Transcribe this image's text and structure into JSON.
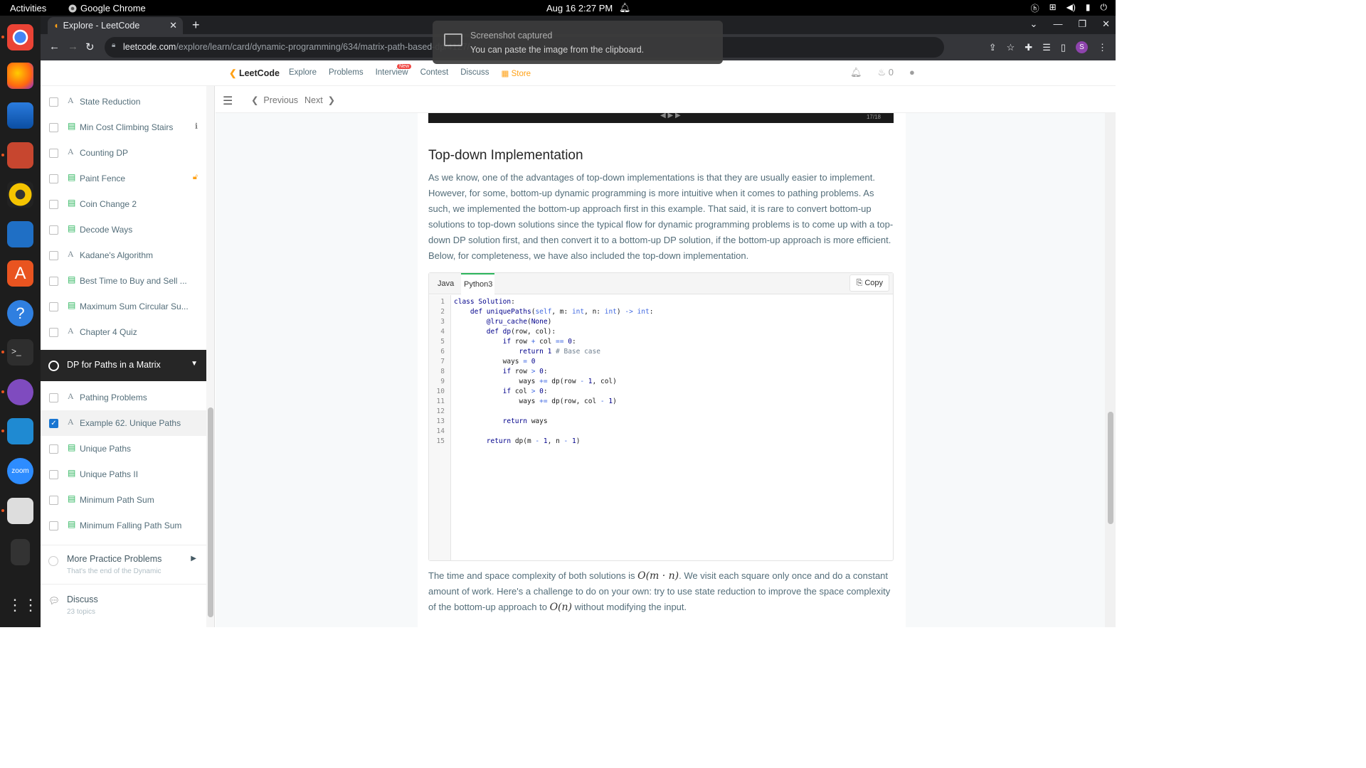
{
  "os": {
    "activities": "Activities",
    "app_name": "Google Chrome",
    "clock": "Aug 16  2:27 PM"
  },
  "browser": {
    "tab_title": "Explore - LeetCode",
    "url_host": "leetcode.com",
    "url_path": "/explore/learn/card/dynamic-programming/634/matrix-path-based-dp/4127/",
    "profile_initial": "S"
  },
  "toast": {
    "title": "Screenshot captured",
    "body": "You can paste the image from the clipboard."
  },
  "header": {
    "logo": "LeetCode",
    "nav": [
      "Explore",
      "Problems",
      "Interview",
      "Contest",
      "Discuss"
    ],
    "new_badge": "New",
    "store": "Store",
    "streak_count": "0"
  },
  "sidebar": {
    "items": [
      {
        "type": "A",
        "label": "State Reduction",
        "trail": ""
      },
      {
        "type": "doc",
        "label": "Min Cost Climbing Stairs",
        "trail": "info"
      },
      {
        "type": "A",
        "label": "Counting DP",
        "trail": ""
      },
      {
        "type": "doc",
        "label": "Paint Fence",
        "trail": "lock"
      },
      {
        "type": "doc",
        "label": "Coin Change 2",
        "trail": ""
      },
      {
        "type": "doc",
        "label": "Decode Ways",
        "trail": ""
      },
      {
        "type": "A",
        "label": "Kadane's Algorithm",
        "trail": ""
      },
      {
        "type": "doc",
        "label": "Best Time to Buy and Sell ...",
        "trail": ""
      },
      {
        "type": "doc",
        "label": "Maximum Sum Circular Su...",
        "trail": ""
      },
      {
        "type": "A",
        "label": "Chapter 4 Quiz",
        "trail": ""
      }
    ],
    "chapter": "DP for Paths in a Matrix",
    "chapter_items": [
      {
        "type": "A",
        "label": "Pathing Problems",
        "checked": false
      },
      {
        "type": "A",
        "label": "Example 62. Unique Paths",
        "checked": true
      },
      {
        "type": "doc",
        "label": "Unique Paths",
        "checked": false
      },
      {
        "type": "doc",
        "label": "Unique Paths II",
        "checked": false
      },
      {
        "type": "doc",
        "label": "Minimum Path Sum",
        "checked": false
      },
      {
        "type": "doc",
        "label": "Minimum Falling Path Sum",
        "checked": false
      }
    ],
    "more_title": "More Practice Problems",
    "more_sub": "That's the end of the Dynamic",
    "discuss_title": "Discuss",
    "discuss_sub": "23 topics"
  },
  "toolbar": {
    "previous": "Previous",
    "next": "Next"
  },
  "article": {
    "video_counter": "17/18",
    "heading": "Top-down Implementation",
    "paragraph": "As we know, one of the advantages of top-down implementations is that they are usually easier to implement. However, for some, bottom-up dynamic programming is more intuitive when it comes to pathing problems. As such, we implemented the bottom-up approach first in this example. That said, it is rare to convert bottom-up solutions to top-down solutions since the typical flow for dynamic programming problems is to come up with a top-down DP solution first, and then convert it to a bottom-up DP solution, if the bottom-up approach is more efficient. Below, for completeness, we have also included the top-down implementation.",
    "code_tabs": [
      "Java",
      "Python3"
    ],
    "copy_label": "Copy",
    "para2_a": "The time and space complexity of both solutions is ",
    "math1": "O(m · n)",
    "para2_b": ". We visit each square only once and do a constant amount of work. Here's a challenge to do on your own: try to use state reduction to improve the space complexity of the bottom-up approach to ",
    "math2": "O(n)",
    "para2_c": " without modifying the input."
  }
}
